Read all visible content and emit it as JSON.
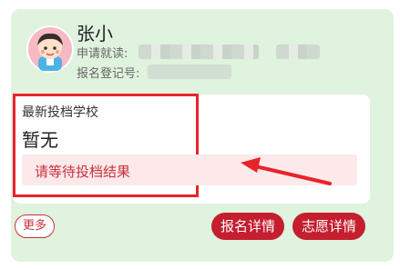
{
  "student": {
    "name": "张小",
    "apply_label": "申请就读:",
    "reg_label": "报名登记号:"
  },
  "placement": {
    "label": "最新投档学校",
    "value": "暂无",
    "status": "请等待投档结果"
  },
  "actions": {
    "more": "更多",
    "registration": "报名详情",
    "wish": "志愿详情"
  },
  "colors": {
    "card_bg": "#dff3df",
    "accent_red": "#c41e2f",
    "highlight_red": "#e8232b",
    "status_bg": "#fde9ea"
  }
}
